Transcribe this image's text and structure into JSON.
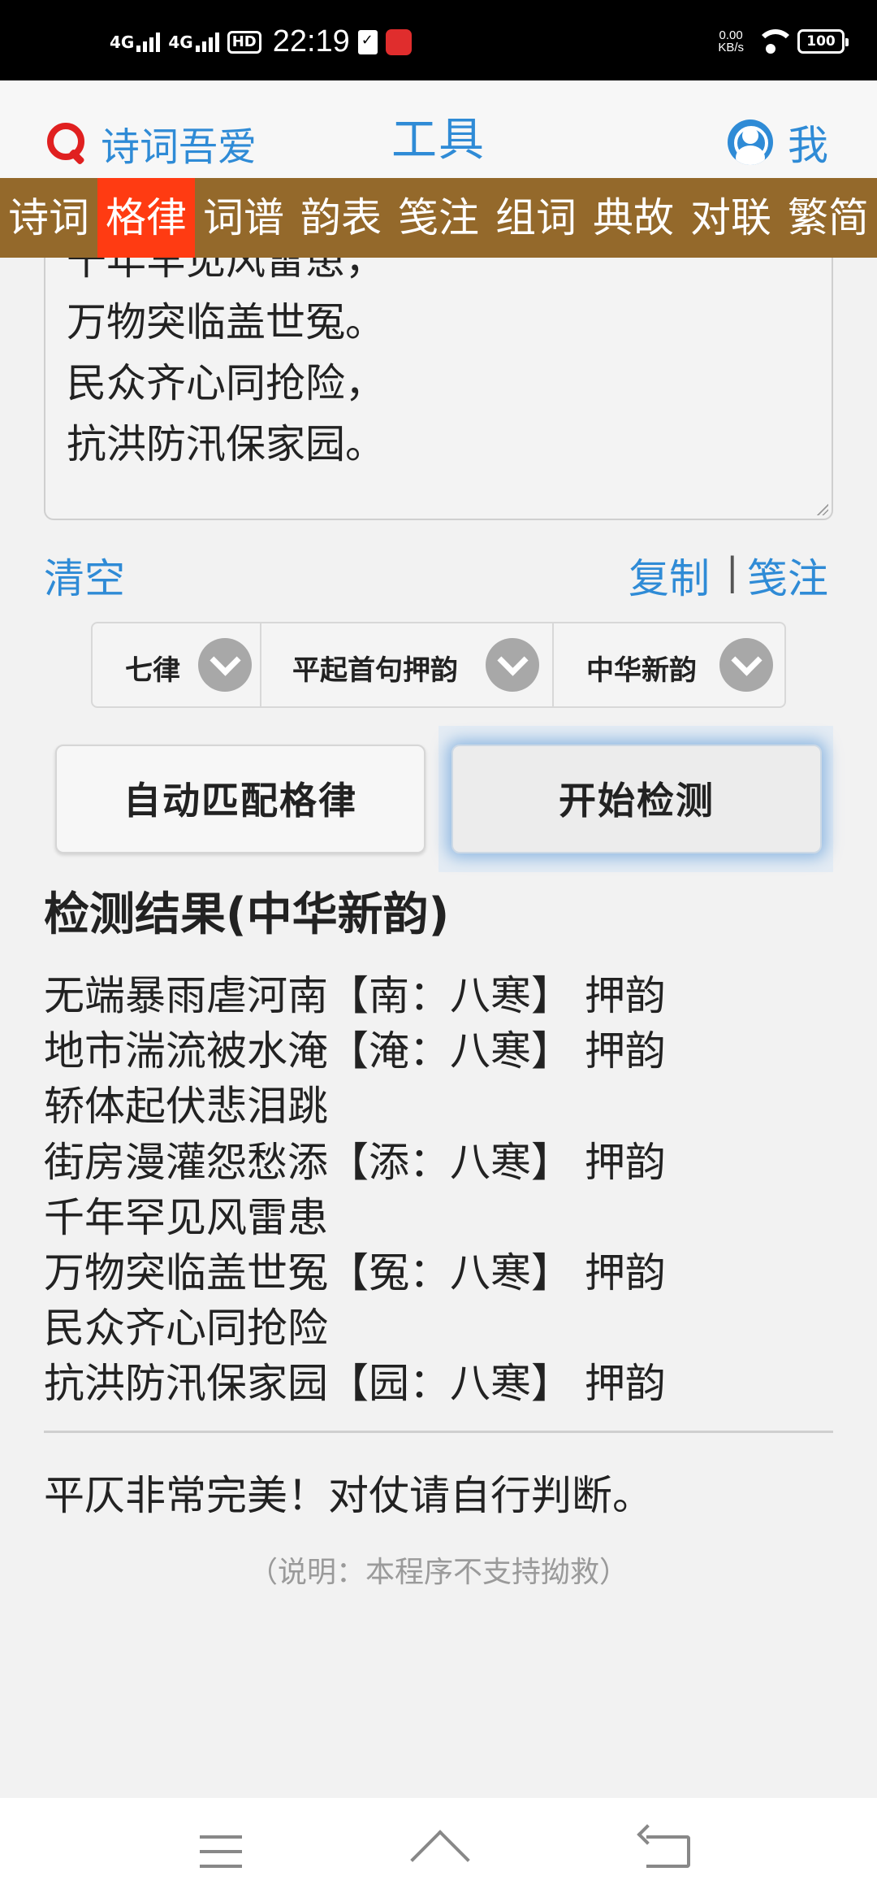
{
  "status_bar": {
    "network1": "4G",
    "network2": "4G",
    "hd": "HD",
    "time": "22:19",
    "speed_value": "0.00",
    "speed_unit": "KB/s",
    "battery": "100"
  },
  "header": {
    "search_label": "诗词吾爱",
    "title": "工具",
    "me_label": "我"
  },
  "nav": {
    "items": [
      "诗词",
      "格律",
      "词谱",
      "韵表",
      "笺注",
      "组词",
      "典故",
      "对联",
      "繁简"
    ],
    "active": "格律"
  },
  "editor": {
    "lines": [
      "千年罕见风雷患，",
      "万物突临盖世冤。",
      "民众齐心同抢险，",
      "抗洪防汛保家园。"
    ]
  },
  "actions": {
    "clear": "清空",
    "copy": "复制",
    "separator": "|",
    "annotate": "笺注"
  },
  "selects": {
    "form": "七律",
    "rhyme_start": "平起首句押韵",
    "rhyme_book": "中华新韵"
  },
  "buttons": {
    "auto_match": "自动匹配格律",
    "start_check": "开始检测"
  },
  "results": {
    "title": "检测结果(中华新韵)",
    "lines": [
      "无端暴雨虐河南【南：八寒】 押韵",
      "地市湍流被水淹【淹：八寒】 押韵",
      "轿体起伏悲泪跳",
      "街房漫灌怨愁添【添：八寒】 押韵",
      "千年罕见风雷患",
      "万物突临盖世冤【冤：八寒】 押韵",
      "民众齐心同抢险",
      "抗洪防汛保家园【园：八寒】 押韵"
    ],
    "summary": "平仄非常完美！对仗请自行判断。",
    "note": "（说明：本程序不支持拗救）"
  },
  "colors": {
    "accent": "#2f8bd6",
    "nav_bg": "#94692b",
    "nav_active": "#ff3b12",
    "search_icon": "#e02020"
  }
}
